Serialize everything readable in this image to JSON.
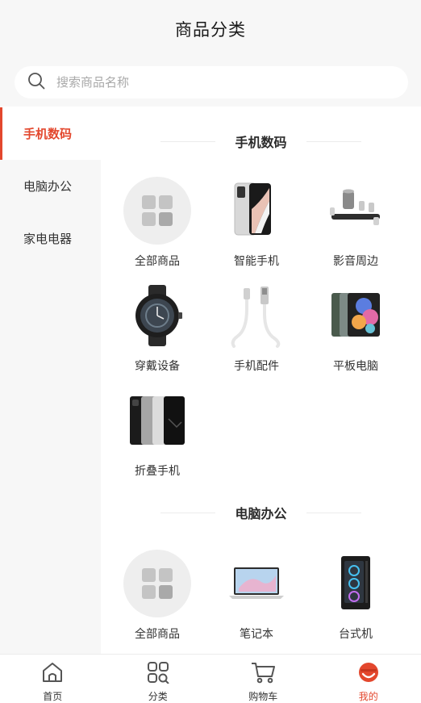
{
  "header": {
    "title": "商品分类"
  },
  "search": {
    "placeholder": "搜索商品名称"
  },
  "sidebar": {
    "items": [
      {
        "label": "手机数码"
      },
      {
        "label": "电脑办公"
      },
      {
        "label": "家电电器"
      }
    ]
  },
  "sections": [
    {
      "title": "手机数码",
      "items": [
        {
          "label": "全部商品",
          "icon": "grid-icon"
        },
        {
          "label": "智能手机",
          "icon": "phone-icon"
        },
        {
          "label": "影音周边",
          "icon": "speaker-icon"
        },
        {
          "label": "穿戴设备",
          "icon": "watch-icon"
        },
        {
          "label": "手机配件",
          "icon": "cable-icon"
        },
        {
          "label": "平板电脑",
          "icon": "tablet-icon"
        },
        {
          "label": "折叠手机",
          "icon": "foldable-phone-icon"
        }
      ]
    },
    {
      "title": "电脑办公",
      "items": [
        {
          "label": "全部商品",
          "icon": "grid-icon"
        },
        {
          "label": "笔记本",
          "icon": "laptop-icon"
        },
        {
          "label": "台式机",
          "icon": "desktop-tower-icon"
        }
      ]
    }
  ],
  "tabbar": {
    "items": [
      {
        "label": "首页",
        "icon": "home-icon"
      },
      {
        "label": "分类",
        "icon": "category-icon"
      },
      {
        "label": "购物车",
        "icon": "cart-icon"
      },
      {
        "label": "我的",
        "icon": "profile-icon"
      }
    ],
    "active_index": 3
  },
  "colors": {
    "accent": "#e3472d",
    "panel": "#f7f7f7"
  }
}
